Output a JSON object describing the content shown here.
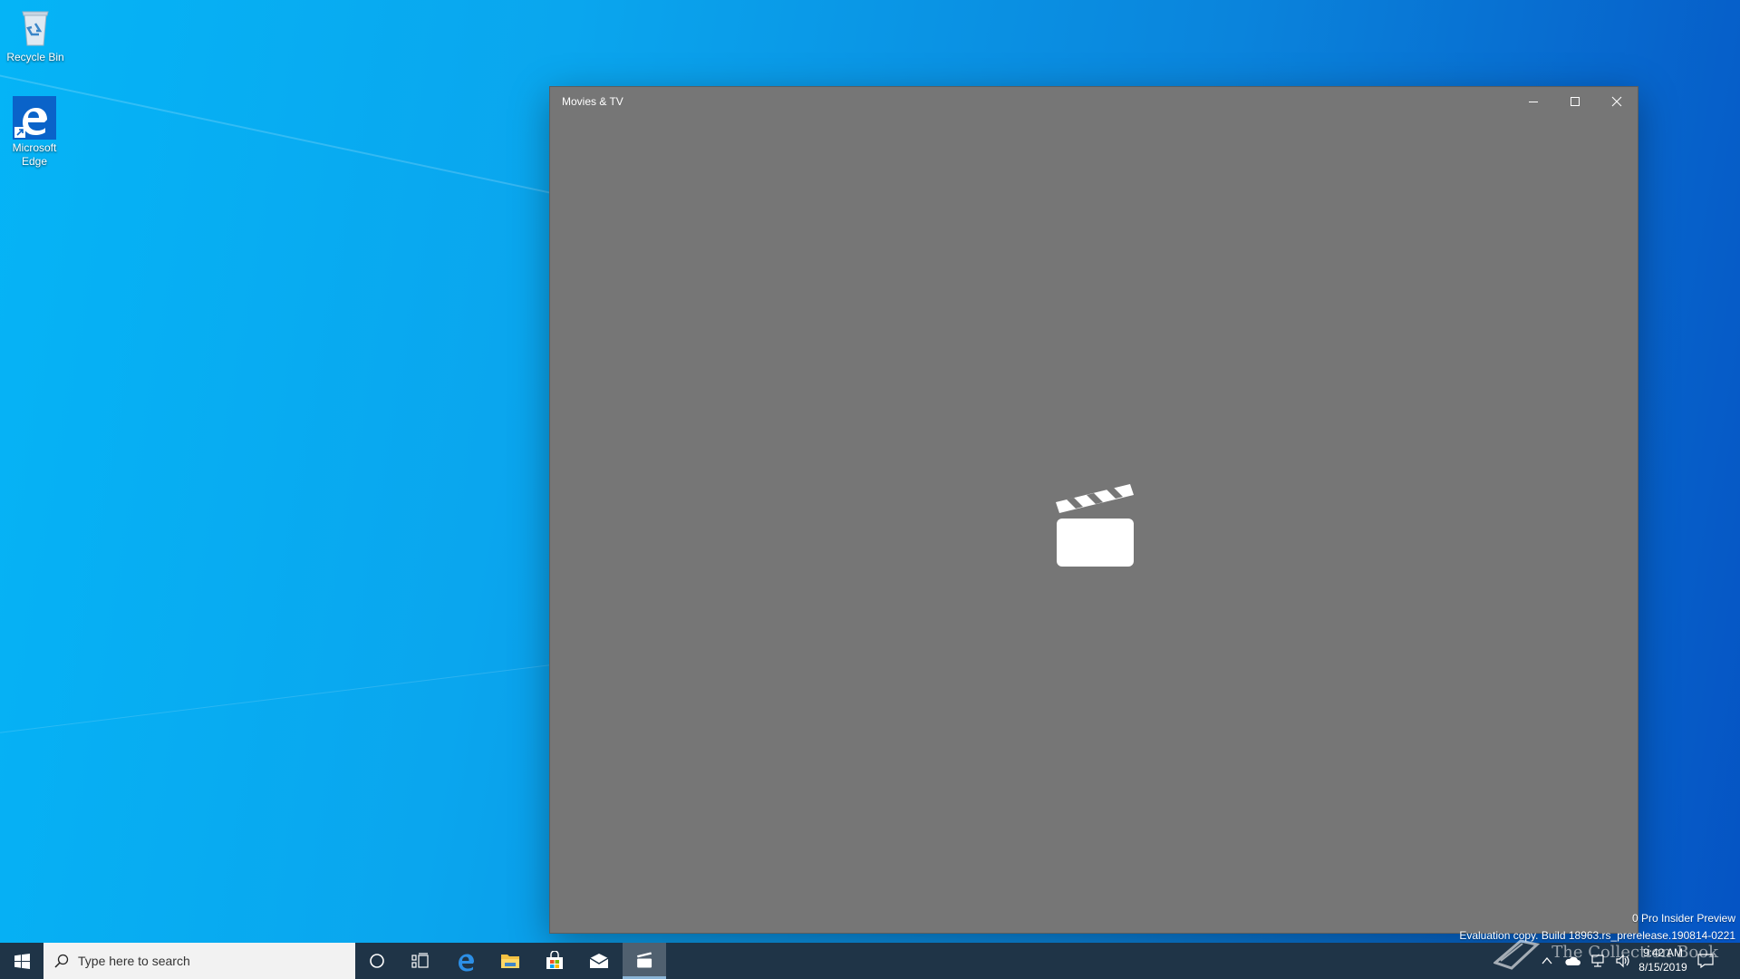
{
  "desktop": {
    "icons": [
      {
        "label": "Recycle Bin",
        "icon": "recycle-bin-icon"
      },
      {
        "label": "Microsoft Edge",
        "icon": "edge-icon"
      }
    ]
  },
  "window": {
    "title": "Movies & TV",
    "controls": {
      "minimize": "minimize-icon",
      "maximize": "maximize-icon",
      "close": "close-icon"
    },
    "splash_icon": "clapperboard-icon",
    "background": "#767676"
  },
  "taskbar": {
    "search_placeholder": "Type here to search",
    "pinned": [
      "cortana-icon",
      "task-view-icon",
      "edge-icon",
      "file-explorer-icon",
      "store-icon",
      "mail-icon",
      "movies-tv-icon"
    ],
    "clock": {
      "time": "9:42 AM",
      "date": "8/15/2019"
    }
  },
  "watermark": {
    "line1": "0 Pro Insider Preview",
    "line2": "Evaluation copy. Build 18963.rs_prerelease.190814-0221"
  },
  "brand": "The Collection Book"
}
